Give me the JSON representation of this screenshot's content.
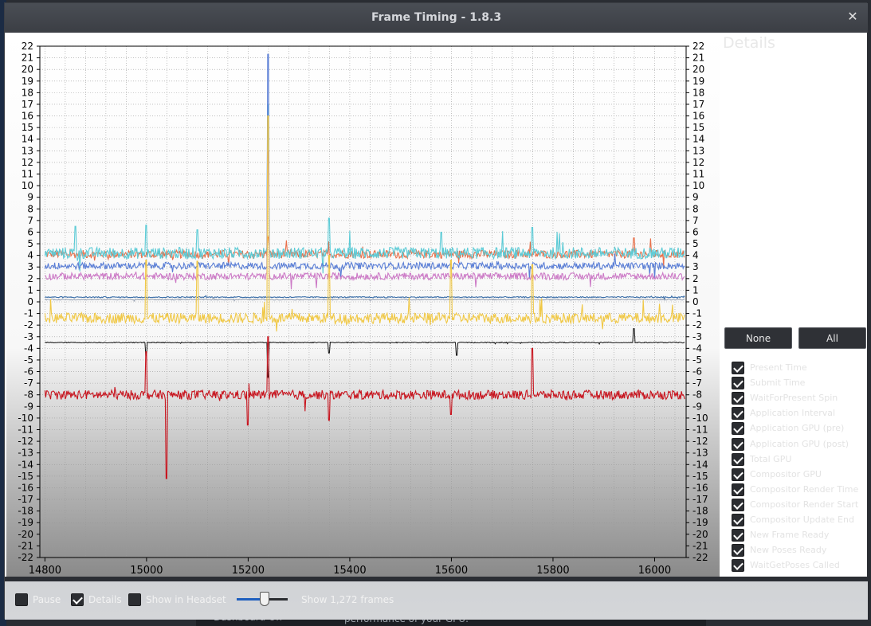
{
  "window": {
    "title": "Frame Timing - 1.8.3",
    "close_glyph": "✕"
  },
  "background_hint": {
    "left_text": "Dashboard On",
    "right_text": "performance of your GPU."
  },
  "details": {
    "title": "Details",
    "none_label": "None",
    "all_label": "All",
    "metrics": [
      {
        "label": "Present Time",
        "checked": true
      },
      {
        "label": "Submit Time",
        "checked": true
      },
      {
        "label": "WaitForPresent Spin",
        "checked": true
      },
      {
        "label": "Application Interval",
        "checked": true
      },
      {
        "label": "Application GPU (pre)",
        "checked": true
      },
      {
        "label": "Application GPU (post)",
        "checked": true
      },
      {
        "label": "Total GPU",
        "checked": true
      },
      {
        "label": "Compositor GPU",
        "checked": true
      },
      {
        "label": "Compositor Render Time",
        "checked": true
      },
      {
        "label": "Compositor Render Start",
        "checked": true
      },
      {
        "label": "Compositor Update End",
        "checked": true
      },
      {
        "label": "New Frame Ready",
        "checked": true
      },
      {
        "label": "New Poses Ready",
        "checked": true
      },
      {
        "label": "WaitGetPoses Called",
        "checked": true
      }
    ]
  },
  "controls": {
    "pause_label": "Pause",
    "pause_checked": false,
    "details_label": "Details",
    "details_checked": true,
    "headset_label": "Show in Headset",
    "headset_checked": false,
    "frames_label": "Show 1,272 frames",
    "slider_level": 0.55
  },
  "chart_data": {
    "type": "line",
    "x_ticks": [
      14800,
      15000,
      15200,
      15400,
      15600,
      15800,
      16000
    ],
    "xlim": [
      14790,
      16062
    ],
    "ylim": [
      -22,
      22
    ],
    "y_ticks": [
      22,
      21,
      20,
      19,
      18,
      17,
      16,
      15,
      14,
      13,
      12,
      11,
      10,
      9,
      8,
      7,
      6,
      5,
      4,
      3,
      2,
      1,
      0,
      -1,
      -2,
      -3,
      -4,
      -5,
      -6,
      -7,
      -8,
      -9,
      -10,
      -11,
      -12,
      -13,
      -14,
      -15,
      -16,
      -17,
      -18,
      -19,
      -20,
      -21,
      -22
    ],
    "grid": true,
    "series": [
      {
        "color": "#e8704a",
        "base": 4.1,
        "noise": 0.35,
        "spikes": [
          [
            15240,
            5.6
          ],
          [
            15960,
            5.5
          ]
        ]
      },
      {
        "color": "#5ccbd6",
        "base": 4.2,
        "noise": 0.5,
        "spikes": [
          [
            14860,
            6.5
          ],
          [
            15000,
            6.6
          ],
          [
            15100,
            6.2
          ],
          [
            15240,
            17
          ],
          [
            15360,
            7.2
          ],
          [
            15580,
            6.0
          ],
          [
            15760,
            6.4
          ]
        ]
      },
      {
        "color": "#5b7fd6",
        "base": 3.1,
        "noise": 0.3,
        "spikes": [
          [
            15240,
            21.3
          ]
        ]
      },
      {
        "color": "#cc7ac6",
        "base": 2.2,
        "noise": 0.3,
        "spikes": [
          [
            15240,
            13
          ]
        ]
      },
      {
        "color": "#3b6ea8",
        "base": 0.4,
        "noise": 0.05,
        "spikes": []
      },
      {
        "color": "#9aa4b4",
        "base": 0.2,
        "noise": 0.05,
        "spikes": []
      },
      {
        "color": "#f0c846",
        "base": -1.4,
        "noise": 0.45,
        "spikes": [
          [
            15000,
            3.6
          ],
          [
            15100,
            3.5
          ],
          [
            15240,
            16
          ],
          [
            15360,
            4.0
          ],
          [
            15600,
            3.6
          ],
          [
            15760,
            3.2
          ]
        ]
      },
      {
        "color": "#111111",
        "base": -3.5,
        "noise": 0.04,
        "spikes": [
          [
            15000,
            -4.6
          ],
          [
            15240,
            -6.5
          ],
          [
            15360,
            -4.4
          ],
          [
            15610,
            -4.6
          ],
          [
            15960,
            -2.3
          ]
        ]
      },
      {
        "color": "#c8141e",
        "base": -8.0,
        "noise": 0.4,
        "spikes": [
          [
            15040,
            -15.2
          ],
          [
            15000,
            -4.3
          ],
          [
            15200,
            -10.6
          ],
          [
            15240,
            -3.0
          ],
          [
            15360,
            -10.2
          ],
          [
            15600,
            -9.7
          ],
          [
            15760,
            -4.0
          ]
        ]
      }
    ]
  }
}
